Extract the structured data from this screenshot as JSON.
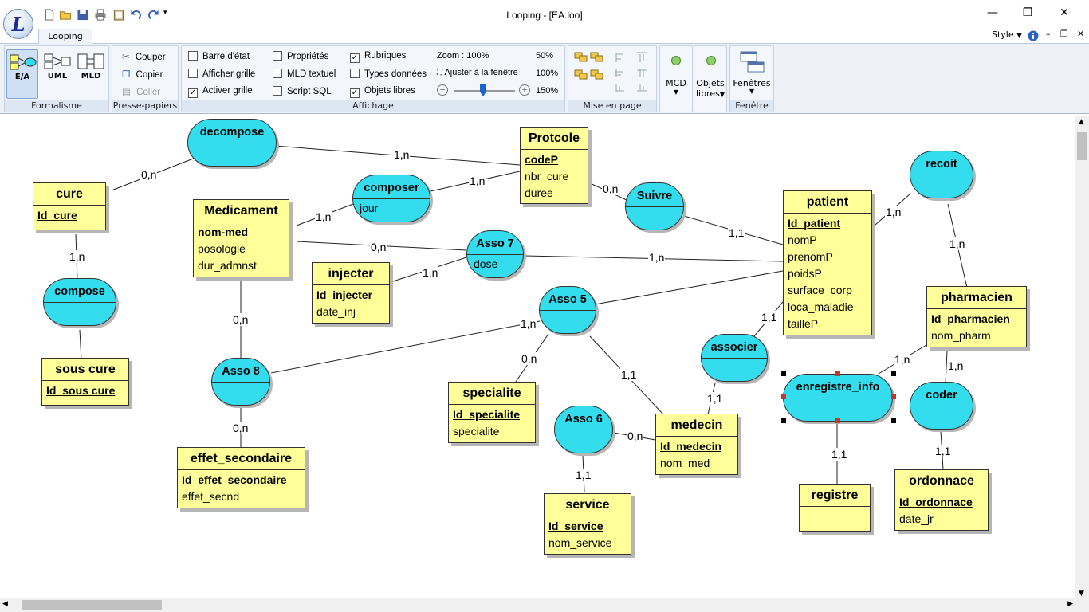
{
  "app": {
    "logo_letter": "L",
    "title": "Looping - [EA.loo]"
  },
  "tabs": {
    "looping": "Looping",
    "style": "Style"
  },
  "ribbon": {
    "formalisme": {
      "label": "Formalisme",
      "ea": "E/A",
      "uml": "UML",
      "mld": "MLD"
    },
    "clipboard": {
      "label": "Presse-papiers",
      "cut": "Couper",
      "copy": "Copier",
      "paste": "Coller"
    },
    "affichage": {
      "label": "Affichage",
      "barre_etat": "Barre d'état",
      "afficher_grille": "Afficher grille",
      "activer_grille": "Activer grille",
      "proprietes": "Propriétés",
      "mld_textuel": "MLD textuel",
      "script_sql": "Script SQL",
      "rubriques": "Rubriques",
      "types_donnees": "Types données",
      "objets_libres": "Objets libres",
      "zoom": "Zoom : 100%",
      "zoom_50": "50%",
      "ajuster": "Ajuster à la fenêtre",
      "zoom_100": "100%",
      "zoom_150": "150%",
      "checked": {
        "barre_etat": false,
        "afficher_grille": false,
        "activer_grille": true,
        "proprietes": false,
        "mld_textuel": false,
        "script_sql": false,
        "rubriques": true,
        "types_donnees": false,
        "objets_libres": true
      }
    },
    "mise_en_page": {
      "label": "Mise en page"
    },
    "mcd": {
      "label": "MCD"
    },
    "objets": {
      "label1": "Objets",
      "label2": "libres"
    },
    "fenetres": {
      "label": "Fenêtres",
      "group_label": "Fenêtre"
    }
  },
  "diagram": {
    "entities": [
      {
        "id": "protcole",
        "name": "Protcole",
        "attrs": [
          {
            "t": "codeP",
            "key": true
          },
          {
            "t": "nbr_cure"
          },
          {
            "t": "duree"
          }
        ]
      },
      {
        "id": "cure",
        "name": "cure",
        "attrs": [
          {
            "t": "Id_cure",
            "key": true
          }
        ]
      },
      {
        "id": "medicament",
        "name": "Medicament",
        "attrs": [
          {
            "t": "nom-med",
            "key": true
          },
          {
            "t": "posologie"
          },
          {
            "t": "dur_admnst"
          }
        ]
      },
      {
        "id": "patient",
        "name": "patient",
        "attrs": [
          {
            "t": "Id_patient",
            "key": true
          },
          {
            "t": "nomP"
          },
          {
            "t": "prenomP"
          },
          {
            "t": "poidsP"
          },
          {
            "t": "surface_corp"
          },
          {
            "t": "loca_maladie"
          },
          {
            "t": "tailleP"
          }
        ]
      },
      {
        "id": "injecter",
        "name": "injecter",
        "attrs": [
          {
            "t": "Id_injecter",
            "key": true
          },
          {
            "t": "date_inj"
          }
        ]
      },
      {
        "id": "pharmacien",
        "name": "pharmacien",
        "attrs": [
          {
            "t": "Id_pharmacien",
            "key": true
          },
          {
            "t": "nom_pharm"
          }
        ]
      },
      {
        "id": "sous_cure",
        "name": "sous cure",
        "attrs": [
          {
            "t": "Id_sous cure",
            "key": true
          }
        ]
      },
      {
        "id": "specialite",
        "name": "specialite",
        "attrs": [
          {
            "t": "Id_specialite",
            "key": true
          },
          {
            "t": "specialite"
          }
        ]
      },
      {
        "id": "effet_secondaire",
        "name": "effet_secondaire",
        "attrs": [
          {
            "t": "Id_effet_secondaire",
            "key": true
          },
          {
            "t": "effet_secnd"
          }
        ]
      },
      {
        "id": "medecin",
        "name": "medecin",
        "attrs": [
          {
            "t": "Id_medecin",
            "key": true
          },
          {
            "t": "nom_med"
          }
        ]
      },
      {
        "id": "service",
        "name": "service",
        "attrs": [
          {
            "t": "Id_service",
            "key": true
          },
          {
            "t": "nom_service"
          }
        ]
      },
      {
        "id": "registre",
        "name": "registre",
        "attrs": []
      },
      {
        "id": "ordonnace",
        "name": "ordonnace",
        "attrs": [
          {
            "t": "Id_ordonnace",
            "key": true
          },
          {
            "t": "date_jr"
          }
        ]
      }
    ],
    "associations": [
      {
        "id": "decompose",
        "name": "decompose",
        "attr": ""
      },
      {
        "id": "composer",
        "name": "composer",
        "attr": "jour"
      },
      {
        "id": "suivre",
        "name": "Suivre",
        "attr": ""
      },
      {
        "id": "recoit",
        "name": "recoit",
        "attr": ""
      },
      {
        "id": "asso7",
        "name": "Asso 7",
        "attr": "dose"
      },
      {
        "id": "compose",
        "name": "compose",
        "attr": ""
      },
      {
        "id": "asso5",
        "name": "Asso 5",
        "attr": ""
      },
      {
        "id": "associer",
        "name": "associer",
        "attr": ""
      },
      {
        "id": "asso8",
        "name": "Asso 8",
        "attr": ""
      },
      {
        "id": "enregistre_info",
        "name": "enregistre_info",
        "attr": ""
      },
      {
        "id": "coder",
        "name": "coder",
        "attr": ""
      },
      {
        "id": "asso6",
        "name": "Asso 6",
        "attr": ""
      }
    ],
    "cardinalities": [
      "1,n",
      "0,n",
      "1,n",
      "0,n",
      "1,n",
      "1,n",
      "1,1",
      "1,n",
      "1,n",
      "0,n",
      "1,n",
      "1,n",
      "1,1",
      "1,n",
      "0,n",
      "0,n",
      "0,n",
      "1,1",
      "1,1",
      "0,n",
      "1,1",
      "1,n",
      "1,n",
      "1,1",
      "1,1"
    ]
  }
}
